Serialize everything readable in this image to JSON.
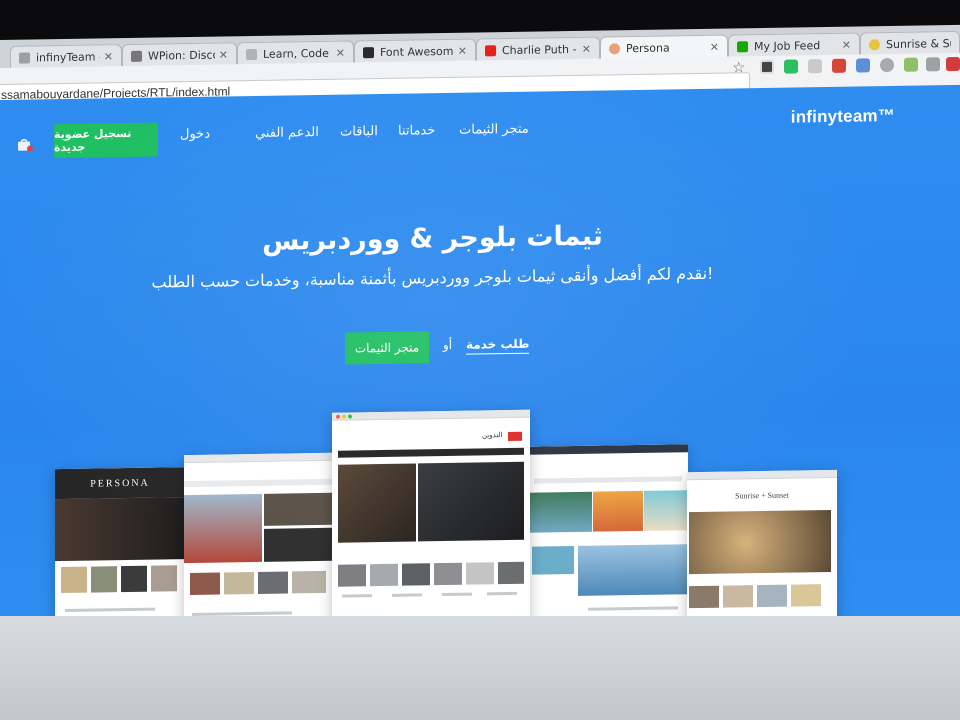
{
  "browser": {
    "tabs": [
      {
        "label": "infinyTeam - سيرة",
        "fav_color": "#9aa0a6",
        "active": false
      },
      {
        "label": "WPion: Discover",
        "fav_color": "#777777",
        "active": false
      },
      {
        "label": "Learn, Code and",
        "fav_color": "#b0b4b8",
        "active": false
      },
      {
        "label": "Font Awesome Ico",
        "fav_color": "#2b2b2b",
        "active": false
      },
      {
        "label": "Charlie Puth - Att",
        "fav_color": "#e62117",
        "active": false
      },
      {
        "label": "Persona",
        "fav_color": "#e8a27a",
        "active": true
      },
      {
        "label": "My Job Feed",
        "fav_color": "#14a800",
        "active": false
      },
      {
        "label": "Sunrise & Suns",
        "fav_color": "#e9c33b",
        "active": false
      }
    ],
    "url": "ssamabouyardane/Projects/RTL/index.html"
  },
  "site": {
    "logo": "infinyteam™",
    "nav": {
      "store": "متجر الثيمات",
      "services": "خدماتنا",
      "plans": "الباقات",
      "support": "الدعم الفني",
      "login": "دخول",
      "signup": "تسجيل عضوية جديدة"
    },
    "hero": {
      "title": "ثيمات بلوجر & ووردبريس",
      "subtitle": "نقدم لكم أفضل وأنقى ثيمات بلوجر ووردبريس بأثمنة مناسبة، وخدمات حسب الطلب!",
      "store_button": "متجر الثيمات",
      "or_text": "أو",
      "request_link": "طلب خدمة"
    },
    "previews": {
      "persona_title": "PERSONA",
      "sunrise_title": "Sunrise + Sunset",
      "center_brand": "التدوين"
    }
  },
  "colors": {
    "hero_blue": "#2a86ec",
    "green": "#1fbf62"
  }
}
